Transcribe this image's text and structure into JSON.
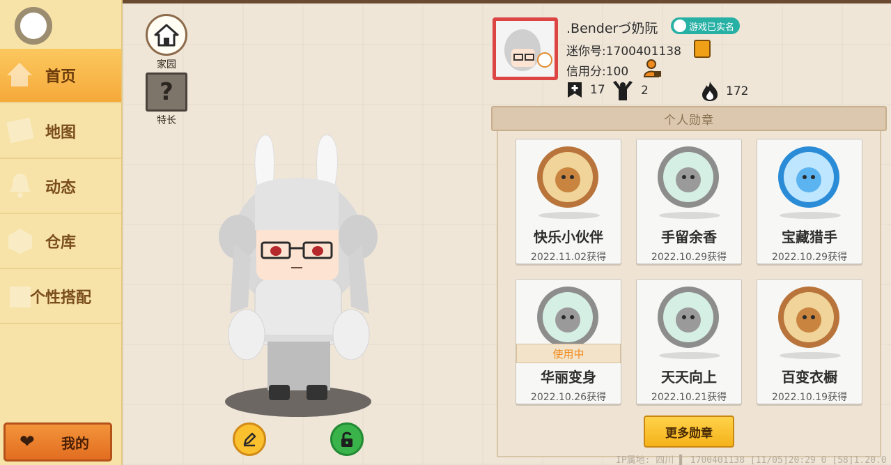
{
  "sidebar": {
    "items": [
      {
        "label": "首页",
        "icon": "home-decor-icon",
        "active": true
      },
      {
        "label": "地图",
        "icon": "map-icon",
        "active": false
      },
      {
        "label": "动态",
        "icon": "bell-icon",
        "active": false
      },
      {
        "label": "仓库",
        "icon": "box-icon",
        "active": false
      },
      {
        "label": "个性搭配",
        "icon": "outfit-icon",
        "active": false
      }
    ],
    "mine_label": "我的"
  },
  "tools": {
    "home_label": "家园",
    "skill_label": "特长"
  },
  "profile": {
    "nickname": ".Benderづ奶阮",
    "verified_label": "游戏已实名",
    "mini_id": "迷你号:1700401138",
    "credit": "信用分:100",
    "stats": {
      "friends": "17",
      "followers": "2",
      "popularity": "172"
    }
  },
  "badges": {
    "title": "个人勋章",
    "items": [
      {
        "name": "快乐小伙伴",
        "date": "2022.11.02获得",
        "style": "bronze",
        "in_use": false
      },
      {
        "name": "手留余香",
        "date": "2022.10.29获得",
        "style": "silver",
        "in_use": false
      },
      {
        "name": "宝藏猎手",
        "date": "2022.10.29获得",
        "style": "blue",
        "in_use": false
      },
      {
        "name": "华丽变身",
        "date": "2022.10.26获得",
        "style": "silver",
        "in_use": true
      },
      {
        "name": "天天向上",
        "date": "2022.10.21获得",
        "style": "silver",
        "in_use": false
      },
      {
        "name": "百变衣橱",
        "date": "2022.10.19获得",
        "style": "bronze",
        "in_use": false
      }
    ],
    "in_use_label": "使用中",
    "more_label": "更多勋章"
  },
  "footer": {
    "text": "IP属地: 四川 ▌   1700401138   [11/05]20:29 0   [58]1.20.0"
  },
  "colors": {
    "sidebar_bg": "#f7e3a7",
    "active_tab": "#f6a93a",
    "accent_orange": "#e26d21",
    "verify_teal": "#27b0a4"
  }
}
